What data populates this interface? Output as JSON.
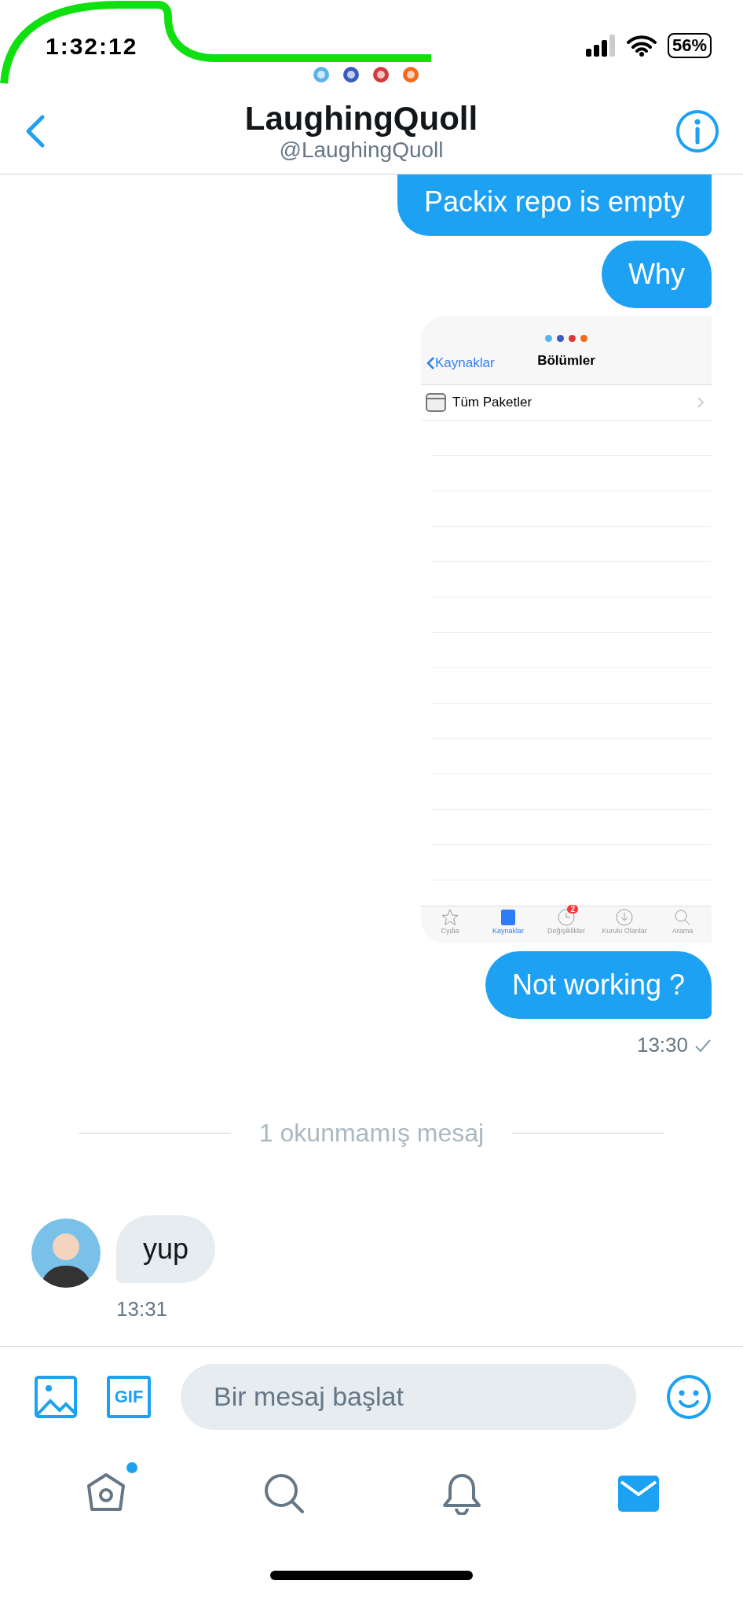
{
  "status_bar": {
    "time": "1:32:12",
    "battery": "56%"
  },
  "header": {
    "title": "LaughingQuoll",
    "handle": "@LaughingQuoll"
  },
  "messages": [
    {
      "kind": "text",
      "text": "Packix repo is empty"
    },
    {
      "kind": "text",
      "text": "Why"
    },
    {
      "kind": "image",
      "screenshot": {
        "back_label": "Kaynaklar",
        "title": "Bölümler",
        "rows": [
          {
            "label": "Tüm Paketler"
          }
        ],
        "tabs": [
          {
            "kind": "star",
            "label": "Cydia",
            "selected": false
          },
          {
            "kind": "box",
            "label": "Kaynaklar",
            "selected": true
          },
          {
            "kind": "clock",
            "label": "Değişiklikler",
            "selected": false,
            "badge": "2"
          },
          {
            "kind": "download",
            "label": "Kurulu Olanlar",
            "selected": false
          },
          {
            "kind": "search",
            "label": "Arama",
            "selected": false
          }
        ]
      }
    },
    {
      "kind": "text",
      "text": "Not working ?"
    }
  ],
  "sent_time": "13:30",
  "unread_divider": "1 okunmamış mesaj",
  "incoming": {
    "text": "yup",
    "time": "13:31"
  },
  "composer": {
    "gif_label": "GIF",
    "placeholder": "Bir mesaj başlat"
  },
  "nav": [
    {
      "kind": "home",
      "selected": false,
      "dot": true
    },
    {
      "kind": "search",
      "selected": false,
      "dot": false
    },
    {
      "kind": "bell",
      "selected": false,
      "dot": false
    },
    {
      "kind": "mail",
      "selected": true,
      "dot": false
    }
  ]
}
